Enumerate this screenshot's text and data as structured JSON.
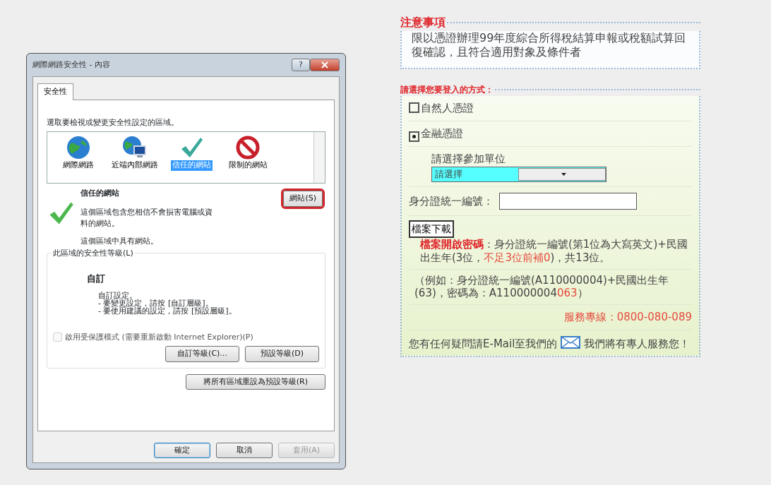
{
  "dialog": {
    "title": "網際網路安全性 - 內容",
    "help_button": "?",
    "tabs": [
      {
        "label": "安全性",
        "selected": true
      }
    ],
    "zone_prompt": "選取要檢視或變更安全性設定的區域。",
    "zones": [
      {
        "label": "網際網路",
        "kind": "internet",
        "selected": false
      },
      {
        "label": "近端內部網路",
        "kind": "intranet",
        "selected": false
      },
      {
        "label": "信任的網站",
        "kind": "trusted",
        "selected": true
      },
      {
        "label": "限制的網站",
        "kind": "restricted",
        "selected": false
      }
    ],
    "zone_info": {
      "title": "信任的網站",
      "description": "這個區域包含您相信不會損害電腦或資料的網站。",
      "note": "這個區域中具有網站。",
      "sites_button": {
        "label": "網站(S)",
        "highlighted": true
      }
    },
    "level_group": {
      "legend": "此區域的安全性等級(L)",
      "level_name": "自訂",
      "lines": [
        "自訂設定。",
        "- 要變更設定，請按 [自訂層級]。",
        "- 要使用建議的設定，請按 [預設層級]。"
      ]
    },
    "protected_mode": {
      "label": "啟用受保護模式 (需要重新啟動 Internet Explorer)(P)",
      "checked": false
    },
    "level_buttons": [
      "自訂等級(C)...",
      "預設等級(D)"
    ],
    "reset_button": "將所有區域重設為預設等級(R)",
    "footer_buttons": [
      {
        "label": "確定",
        "default": true,
        "disabled": false
      },
      {
        "label": "取消",
        "default": false,
        "disabled": false
      },
      {
        "label": "套用(A)",
        "default": false,
        "disabled": true
      }
    ]
  },
  "notice": {
    "title": "注意事項",
    "body": "限以憑證辦理99年度綜合所得稅結算申報或稅額試算回復確認，且符合適用對象及條件者"
  },
  "login": {
    "title": "請選擇您要登入的方式：",
    "methods": [
      {
        "label": "自然人憑證",
        "selected": false
      },
      {
        "label": "金融憑證",
        "selected": true
      }
    ],
    "unit_label": "請選擇參加單位",
    "unit_select": "請選擇",
    "id_label": "身分證統一編號：",
    "download_button": "檔案下載",
    "password_note": [
      {
        "text": "檔案開啟密碼",
        "kind": "emphasis"
      },
      {
        "text": "：身分證統一編號(第1位為大寫英文)+民國出生年(3位，",
        "kind": "normal"
      },
      {
        "text": "不足3位前補0",
        "kind": "highlight"
      },
      {
        "text": ")，共13位。",
        "kind": "normal"
      }
    ],
    "example": [
      {
        "text": "（例如：身分證統一編號(A110000004)+民國出生年(63)，密碼為：A110000004",
        "kind": "normal"
      },
      {
        "text": "063",
        "kind": "highlight"
      },
      {
        "text": "）",
        "kind": "normal"
      }
    ],
    "hotline": "服務專線：0800-080-089",
    "contact": {
      "before": "您有任何疑問請E-Mail至我們的",
      "after": "我們將有專人服務您！"
    }
  }
}
